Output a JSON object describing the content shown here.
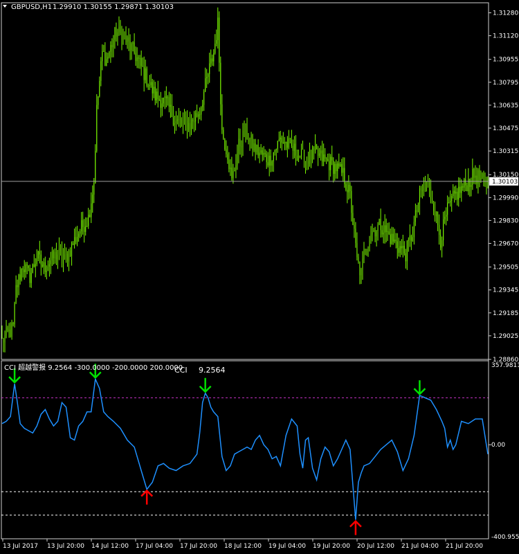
{
  "colors": {
    "background": "#000000",
    "candle": "#7cfc00",
    "grid": "#ffffff",
    "cci_line": "#1e90ff",
    "level_high": "#c030c0",
    "level_low": "#ffffff",
    "arrow_down": "#00e000",
    "arrow_up": "#ff0000",
    "current_price_box": "#ffffff"
  },
  "main_header": {
    "icon": "triangle-down-icon",
    "symbol": "GBPUSD,H1",
    "ohlc": "1.29910 1.30155 1.29871 1.30103"
  },
  "indicator_header": {
    "label": "CCI 超越警报 9.2564 -300.0000 -200.0000 200.0000",
    "center_title": "CCI",
    "center_value": "9.2564"
  },
  "price_axis": {
    "labels": [
      "1.31280",
      "1.31120",
      "1.30955",
      "1.30795",
      "1.30635",
      "1.30475",
      "1.30315",
      "1.30150",
      "1.29990",
      "1.29830",
      "1.29670",
      "1.29505",
      "1.29345",
      "1.29185",
      "1.29025",
      "1.28860"
    ],
    "current_price": "1.30103"
  },
  "cci_axis": {
    "top": "357.9811",
    "zero": "0.00",
    "bottom": "-400.9555"
  },
  "time_axis": {
    "labels": [
      "13 Jul 2017",
      "13 Jul 20:00",
      "14 Jul 12:00",
      "17 Jul 04:00",
      "17 Jul 20:00",
      "18 Jul 12:00",
      "19 Jul 04:00",
      "19 Jul 20:00",
      "20 Jul 12:00",
      "21 Jul 04:00",
      "21 Jul 20:00"
    ]
  },
  "chart_data": [
    {
      "type": "candlestick",
      "title": "GBPUSD,H1",
      "ylim": [
        1.2886,
        1.3135
      ],
      "current_price": 1.30103,
      "key_closes": [
        [
          0,
          1.2899
        ],
        [
          8,
          1.2908
        ],
        [
          10,
          1.2935
        ],
        [
          15,
          1.2952
        ],
        [
          20,
          1.2944
        ],
        [
          25,
          1.2958
        ],
        [
          30,
          1.295
        ],
        [
          40,
          1.296
        ],
        [
          45,
          1.2955
        ],
        [
          55,
          1.2975
        ],
        [
          62,
          1.2985
        ],
        [
          66,
          1.301
        ],
        [
          68,
          1.306
        ],
        [
          72,
          1.31
        ],
        [
          75,
          1.3095
        ],
        [
          82,
          1.3115
        ],
        [
          88,
          1.311
        ],
        [
          95,
          1.31
        ],
        [
          100,
          1.309
        ],
        [
          105,
          1.308
        ],
        [
          110,
          1.307
        ],
        [
          118,
          1.3065
        ],
        [
          125,
          1.3052
        ],
        [
          135,
          1.305
        ],
        [
          142,
          1.306
        ],
        [
          148,
          1.3085
        ],
        [
          152,
          1.31
        ],
        [
          155,
          1.312
        ],
        [
          158,
          1.3045
        ],
        [
          162,
          1.303
        ],
        [
          165,
          1.301
        ],
        [
          170,
          1.3035
        ],
        [
          175,
          1.3045
        ],
        [
          180,
          1.3035
        ],
        [
          185,
          1.303
        ],
        [
          192,
          1.3025
        ],
        [
          200,
          1.304
        ],
        [
          210,
          1.3032
        ],
        [
          218,
          1.3025
        ],
        [
          225,
          1.303
        ],
        [
          232,
          1.3025
        ],
        [
          240,
          1.302
        ],
        [
          245,
          1.3015
        ],
        [
          250,
          1.3
        ],
        [
          255,
          1.2955
        ],
        [
          258,
          1.2945
        ],
        [
          260,
          1.296
        ],
        [
          265,
          1.2975
        ],
        [
          272,
          1.298
        ],
        [
          280,
          1.297
        ],
        [
          285,
          1.2965
        ],
        [
          290,
          1.296
        ],
        [
          295,
          1.2975
        ],
        [
          300,
          1.3
        ],
        [
          305,
          1.301
        ],
        [
          310,
          1.2995
        ],
        [
          315,
          1.297
        ],
        [
          320,
          1.299
        ],
        [
          325,
          1.3
        ],
        [
          330,
          1.3005
        ],
        [
          335,
          1.301
        ],
        [
          340,
          1.3015
        ],
        [
          345,
          1.301
        ]
      ]
    },
    {
      "type": "line",
      "title": "CCI",
      "ylim": [
        -400.9555,
        357.9811
      ],
      "levels": [
        200,
        -200,
        -300
      ],
      "x": [
        0,
        3,
        6,
        9,
        11,
        13,
        16,
        19,
        22,
        25,
        28,
        31,
        34,
        37,
        40,
        43,
        46,
        49,
        52,
        55,
        58,
        61,
        64,
        67,
        70,
        73,
        76,
        80,
        85,
        90,
        95,
        100,
        104,
        108,
        112,
        116,
        120,
        125,
        130,
        135,
        140,
        142,
        144,
        146,
        148,
        150,
        152,
        155,
        158,
        161,
        164,
        167,
        170,
        173,
        176,
        179,
        182,
        185,
        188,
        191,
        194,
        197,
        200,
        204,
        208,
        212,
        214,
        216,
        218,
        220,
        223,
        226,
        229,
        232,
        235,
        238,
        241,
        244,
        247,
        250,
        252,
        254,
        256,
        258,
        260,
        264,
        268,
        272,
        276,
        280,
        284,
        288,
        292,
        296,
        300,
        304,
        308,
        312,
        316,
        318,
        320,
        322,
        324,
        326,
        330,
        335,
        340,
        345,
        349
      ],
      "y": [
        90,
        100,
        120,
        260,
        180,
        90,
        70,
        60,
        50,
        80,
        130,
        150,
        110,
        80,
        100,
        180,
        160,
        30,
        20,
        80,
        100,
        140,
        140,
        280,
        240,
        140,
        120,
        100,
        70,
        20,
        -10,
        -110,
        -190,
        -160,
        -90,
        -80,
        -100,
        -110,
        -90,
        -80,
        -40,
        50,
        180,
        220,
        200,
        160,
        140,
        120,
        -50,
        -110,
        -90,
        -40,
        -30,
        -20,
        -10,
        -20,
        20,
        40,
        0,
        -20,
        -60,
        -50,
        -90,
        40,
        110,
        80,
        -40,
        -100,
        20,
        30,
        -100,
        -150,
        -60,
        -10,
        -30,
        -90,
        -60,
        -20,
        20,
        -20,
        -170,
        -320,
        -160,
        -120,
        -90,
        -80,
        -50,
        -20,
        0,
        20,
        -30,
        -110,
        -60,
        40,
        210,
        200,
        190,
        150,
        100,
        70,
        -10,
        20,
        -20,
        0,
        100,
        90,
        110,
        110,
        -40
      ]
    }
  ]
}
